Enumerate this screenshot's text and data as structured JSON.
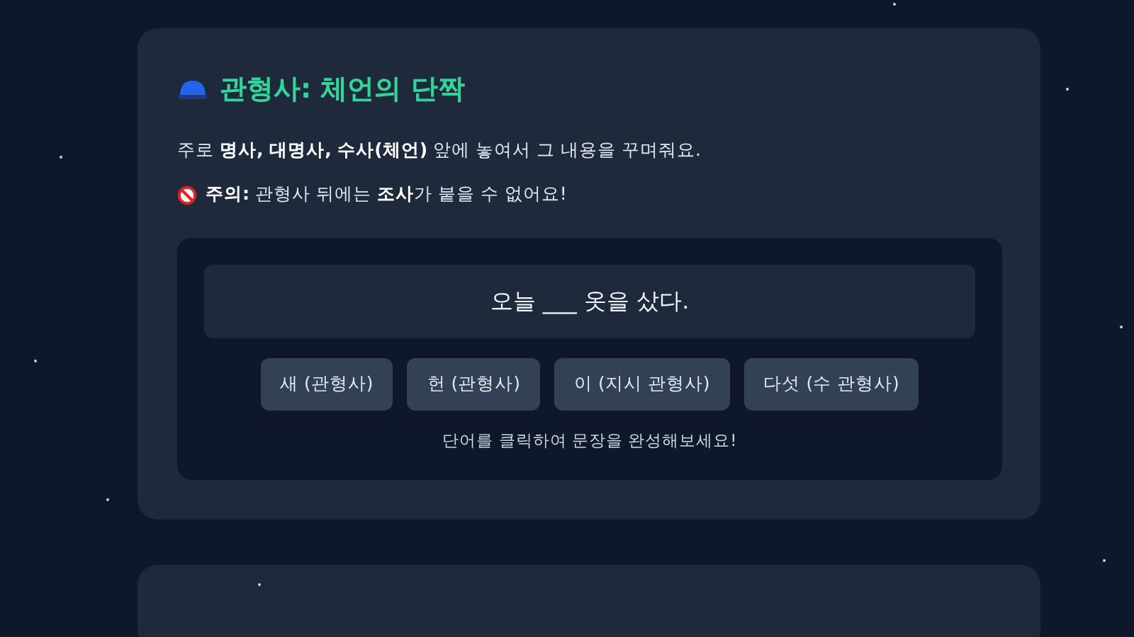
{
  "card": {
    "title": "관형사: 체언의 단짝",
    "description": "주로 **명사, 대명사, 수사(체언)** 앞에 놓여서 그 내용을 꾸며줘요.",
    "warning": "**주의:** 관형사 뒤에는 **조사**가 붙을 수 없어요!",
    "quiz": {
      "sentence": "오늘 ___ 옷을 샀다.",
      "options": [
        {
          "label": "새 (관형사)"
        },
        {
          "label": "헌 (관형사)"
        },
        {
          "label": "이 (지시 관형사)"
        },
        {
          "label": "다섯 (수 관형사)"
        }
      ],
      "hint": "단어를 클릭하여 문장을 완성해보세요!"
    }
  }
}
